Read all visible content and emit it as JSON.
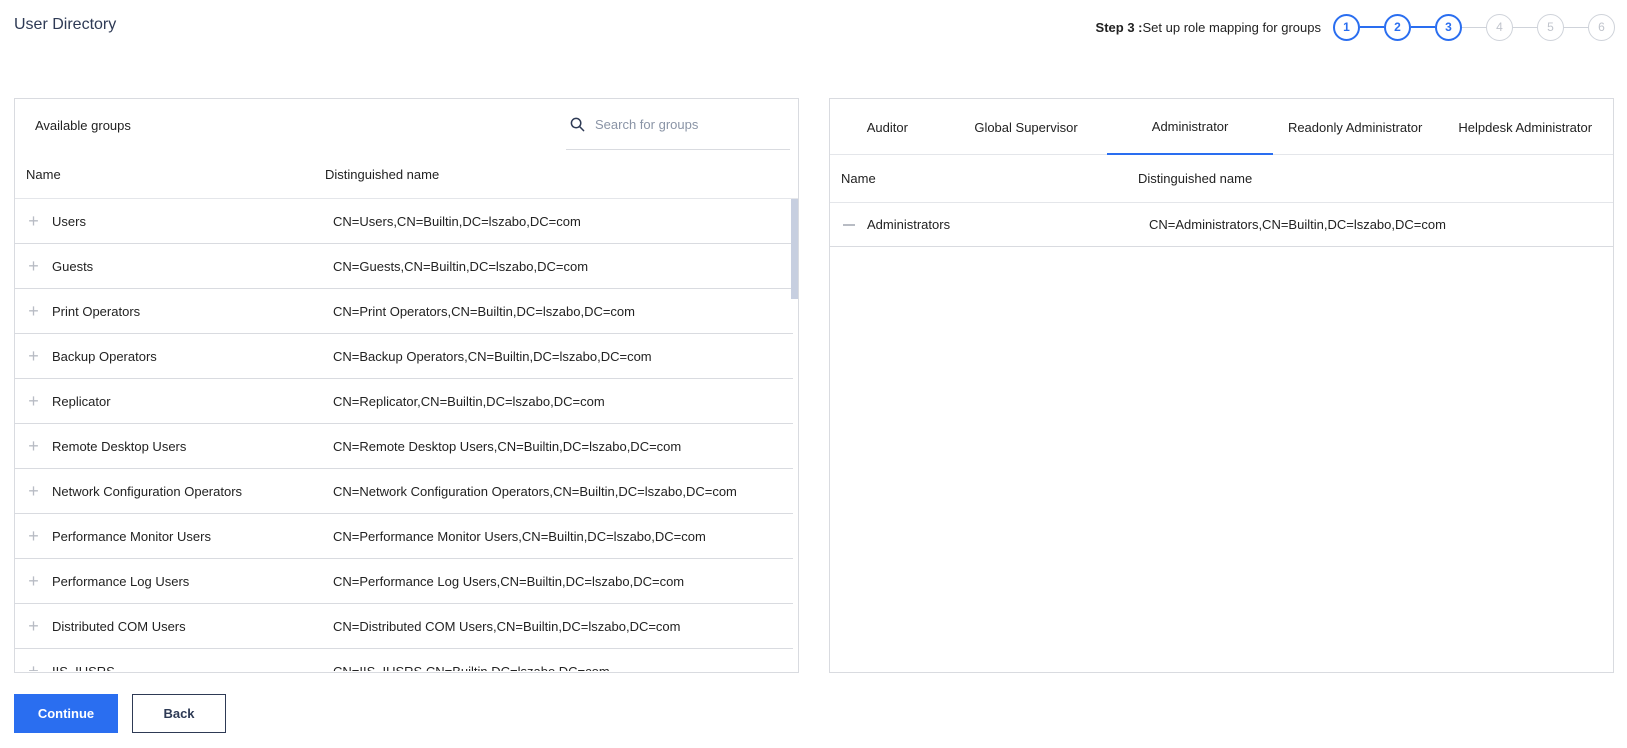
{
  "app": {
    "title": "User Directory"
  },
  "stepper": {
    "step_prefix": "Step 3 :",
    "step_text": "Set up role mapping for groups",
    "steps": [
      "1",
      "2",
      "3",
      "4",
      "5",
      "6"
    ],
    "active_through": 3
  },
  "left_panel": {
    "title": "Available groups",
    "search_placeholder": "Search for groups",
    "columns": {
      "name": "Name",
      "dn": "Distinguished name"
    },
    "rows": [
      {
        "name": "Users",
        "dn": "CN=Users,CN=Builtin,DC=lszabo,DC=com"
      },
      {
        "name": "Guests",
        "dn": "CN=Guests,CN=Builtin,DC=lszabo,DC=com"
      },
      {
        "name": "Print Operators",
        "dn": "CN=Print Operators,CN=Builtin,DC=lszabo,DC=com"
      },
      {
        "name": "Backup Operators",
        "dn": "CN=Backup Operators,CN=Builtin,DC=lszabo,DC=com"
      },
      {
        "name": "Replicator",
        "dn": "CN=Replicator,CN=Builtin,DC=lszabo,DC=com"
      },
      {
        "name": "Remote Desktop Users",
        "dn": "CN=Remote Desktop Users,CN=Builtin,DC=lszabo,DC=com"
      },
      {
        "name": "Network Configuration Operators",
        "dn": "CN=Network Configuration Operators,CN=Builtin,DC=lszabo,DC=com"
      },
      {
        "name": "Performance Monitor Users",
        "dn": "CN=Performance Monitor Users,CN=Builtin,DC=lszabo,DC=com"
      },
      {
        "name": "Performance Log Users",
        "dn": "CN=Performance Log Users,CN=Builtin,DC=lszabo,DC=com"
      },
      {
        "name": "Distributed COM Users",
        "dn": "CN=Distributed COM Users,CN=Builtin,DC=lszabo,DC=com"
      },
      {
        "name": "IIS_IUSRS",
        "dn": "CN=IIS_IUSRS,CN=Builtin,DC=lszabo,DC=com"
      }
    ]
  },
  "right_panel": {
    "tabs": [
      {
        "label": "Auditor",
        "active": false
      },
      {
        "label": "Global Supervisor",
        "active": false
      },
      {
        "label": "Administrator",
        "active": true
      },
      {
        "label": "Readonly Administrator",
        "active": false
      },
      {
        "label": "Helpdesk Administrator",
        "active": false
      }
    ],
    "columns": {
      "name": "Name",
      "dn": "Distinguished name"
    },
    "rows": [
      {
        "name": "Administrators",
        "dn": "CN=Administrators,CN=Builtin,DC=lszabo,DC=com"
      }
    ]
  },
  "buttons": {
    "continue": "Continue",
    "back": "Back"
  },
  "colors": {
    "accent": "#2a6ef0",
    "title": "#2e3a55",
    "border": "#d9dbe0"
  }
}
